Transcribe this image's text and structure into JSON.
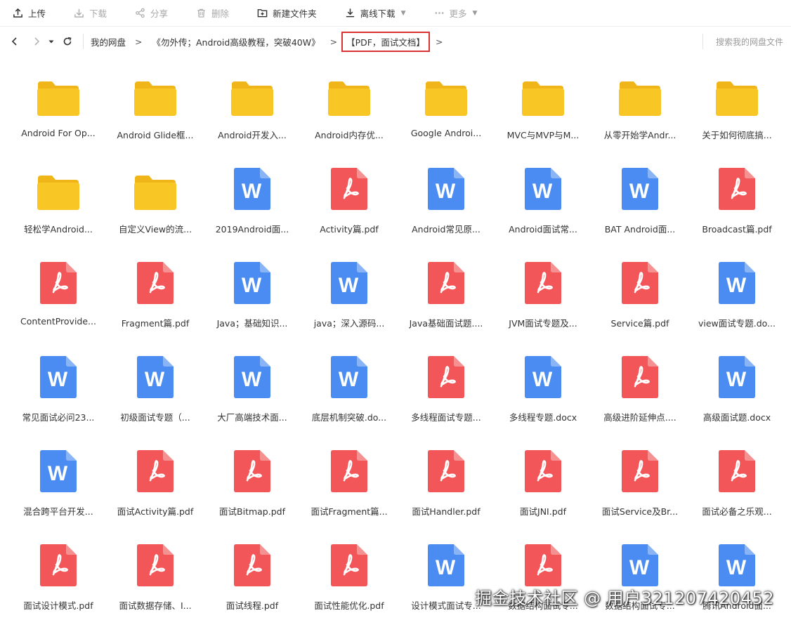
{
  "colors": {
    "folder": "#F8C726",
    "folder_tab": "#F0B619",
    "word": "#4A8CF2",
    "pdf": "#F25658",
    "highlight": "#D93232"
  },
  "toolbar": {
    "upload": "上传",
    "download": "下载",
    "share": "分享",
    "delete": "删除",
    "new_folder": "新建文件夹",
    "offline_download": "离线下载",
    "more": "更多"
  },
  "breadcrumb": {
    "root": "我的网盘",
    "sep": ">",
    "level1": "《勿外传；Android高级教程，突破40W》",
    "current": "【PDF，面试文档】"
  },
  "search": {
    "placeholder": "搜索我的网盘文件"
  },
  "files": [
    {
      "type": "folder",
      "name": "Android For Op..."
    },
    {
      "type": "folder",
      "name": "Android Glide框..."
    },
    {
      "type": "folder",
      "name": "Android开发入..."
    },
    {
      "type": "folder",
      "name": "Android内存优..."
    },
    {
      "type": "folder",
      "name": "Google Androi..."
    },
    {
      "type": "folder",
      "name": "MVC与MVP与M..."
    },
    {
      "type": "folder",
      "name": "从零开始学Andr..."
    },
    {
      "type": "folder",
      "name": "关于如何彻底搞..."
    },
    {
      "type": "folder",
      "name": "轻松学Android..."
    },
    {
      "type": "folder",
      "name": "自定义View的流..."
    },
    {
      "type": "word",
      "name": "2019Android面..."
    },
    {
      "type": "pdf",
      "name": "Activity篇.pdf"
    },
    {
      "type": "word",
      "name": "Android常见原..."
    },
    {
      "type": "word",
      "name": "Android面试常..."
    },
    {
      "type": "word",
      "name": "BAT Android面..."
    },
    {
      "type": "pdf",
      "name": "Broadcast篇.pdf"
    },
    {
      "type": "pdf",
      "name": "ContentProvide..."
    },
    {
      "type": "pdf",
      "name": "Fragment篇.pdf"
    },
    {
      "type": "word",
      "name": "Java；基础知识..."
    },
    {
      "type": "word",
      "name": "java；深入源码..."
    },
    {
      "type": "pdf",
      "name": "Java基础面试题...."
    },
    {
      "type": "pdf",
      "name": "JVM面试专题及..."
    },
    {
      "type": "pdf",
      "name": "Service篇.pdf"
    },
    {
      "type": "word",
      "name": "view面试专题.do..."
    },
    {
      "type": "word",
      "name": "常见面试必问23..."
    },
    {
      "type": "word",
      "name": "初级面试专题（..."
    },
    {
      "type": "word",
      "name": "大厂高端技术面..."
    },
    {
      "type": "word",
      "name": "底层机制突破.do..."
    },
    {
      "type": "pdf",
      "name": "多线程面试专题..."
    },
    {
      "type": "word",
      "name": "多线程专题.docx"
    },
    {
      "type": "pdf",
      "name": "高级进阶延伸点...."
    },
    {
      "type": "word",
      "name": "高级面试题.docx"
    },
    {
      "type": "word",
      "name": "混合跨平台开发..."
    },
    {
      "type": "pdf",
      "name": "面试Activity篇.pdf"
    },
    {
      "type": "pdf",
      "name": "面试Bitmap.pdf"
    },
    {
      "type": "pdf",
      "name": "面试Fragment篇..."
    },
    {
      "type": "pdf",
      "name": "面试Handler.pdf"
    },
    {
      "type": "pdf",
      "name": "面试JNI.pdf"
    },
    {
      "type": "pdf",
      "name": "面试Service及Br..."
    },
    {
      "type": "pdf",
      "name": "面试必备之乐观..."
    },
    {
      "type": "pdf",
      "name": "面试设计模式.pdf"
    },
    {
      "type": "pdf",
      "name": "面试数据存储、I..."
    },
    {
      "type": "pdf",
      "name": "面试线程.pdf"
    },
    {
      "type": "pdf",
      "name": "面试性能优化.pdf"
    },
    {
      "type": "word",
      "name": "设计模式面试专..."
    },
    {
      "type": "pdf",
      "name": "数据结构面试专..."
    },
    {
      "type": "word",
      "name": "数据结构面试专..."
    },
    {
      "type": "word",
      "name": "腾讯Android面..."
    }
  ],
  "watermark": "掘金技术社区 @ 用户3212074204​52"
}
